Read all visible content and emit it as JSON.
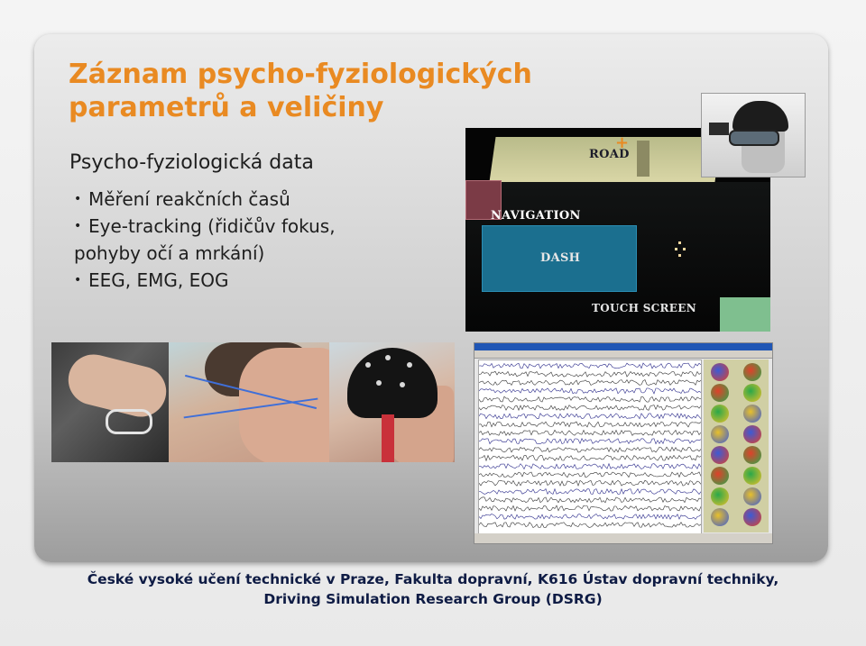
{
  "slide": {
    "title_line1": "Záznam psycho-fyziologických",
    "title_line2": "parametrů a veličiny",
    "subtitle": "Psycho-fyziologická data",
    "bullets": [
      "Měření reakčních časů",
      "Eye-tracking (řidičův fokus,",
      "pohyby očí a mrkání)",
      "EEG, EMG, EOG"
    ],
    "colors": {
      "title": "#e98a22",
      "footer_text": "#0e1b44"
    }
  },
  "simulator_image": {
    "labels": {
      "road": "ROAD",
      "navigation": "NAVIGATION",
      "dash": "DASH",
      "touch_screen": "TOUCH SCREEN"
    }
  },
  "footer": {
    "line1": "České vysoké učení technické v Praze, Fakulta dopravní, K616 Ústav dopravní techniky,",
    "line2": "Driving Simulation Research Group (DSRG)"
  }
}
